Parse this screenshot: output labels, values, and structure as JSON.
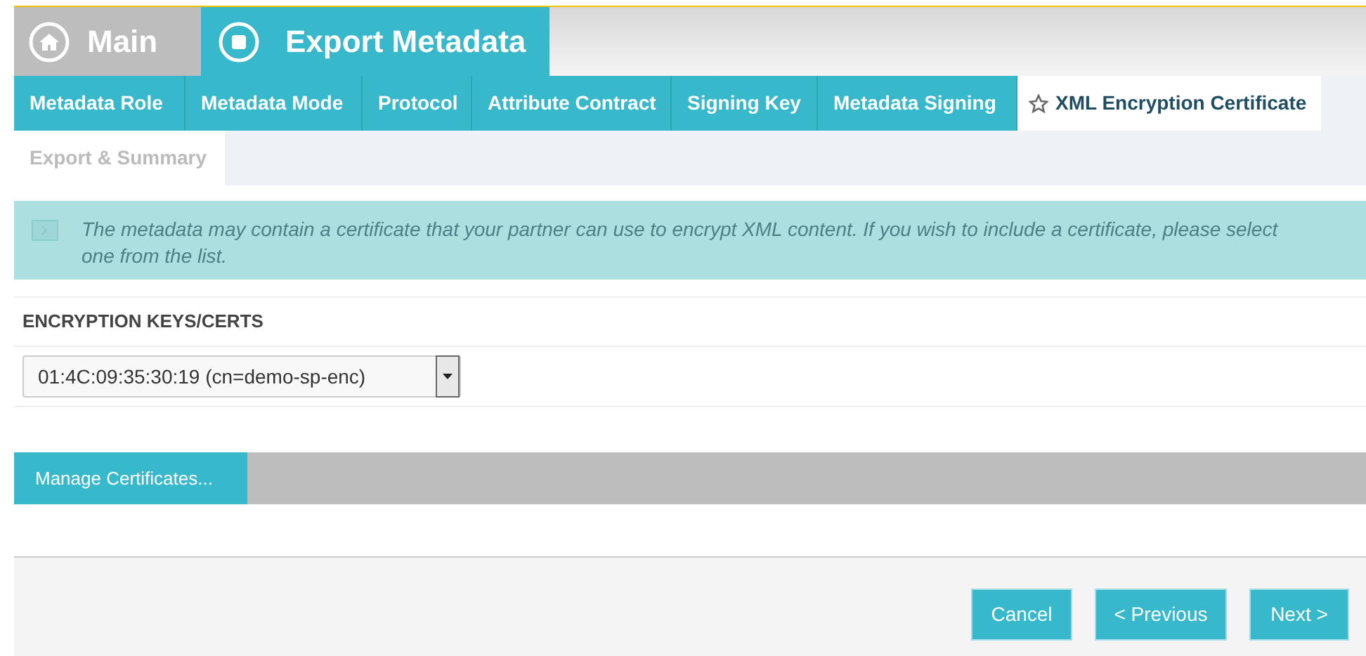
{
  "header_tabs": [
    {
      "label": "Main",
      "kind": "home",
      "selected": false
    },
    {
      "label": "Export Metadata",
      "kind": "stop",
      "selected": true
    }
  ],
  "steps": [
    {
      "label": "Metadata Role",
      "selected": false,
      "disabled": false
    },
    {
      "label": "Metadata Mode",
      "selected": false,
      "disabled": false
    },
    {
      "label": "Protocol",
      "selected": false,
      "disabled": false
    },
    {
      "label": "Attribute Contract",
      "selected": false,
      "disabled": false
    },
    {
      "label": "Signing Key",
      "selected": false,
      "disabled": false
    },
    {
      "label": "Metadata Signing",
      "selected": false,
      "disabled": false
    },
    {
      "label": "XML Encryption Certificate",
      "selected": true,
      "disabled": false
    },
    {
      "label": "Export & Summary",
      "selected": false,
      "disabled": true
    }
  ],
  "info": "The metadata may contain a certificate that your partner can use to encrypt XML content. If you wish to include a certificate, please select one from the list.",
  "field": {
    "label": "ENCRYPTION KEYS/CERTS",
    "value": "01:4C:09:35:30:19 (cn=demo-sp-enc)"
  },
  "manage_button": "Manage Certificates...",
  "footer_buttons": [
    "Cancel",
    "< Previous",
    "Next >"
  ]
}
